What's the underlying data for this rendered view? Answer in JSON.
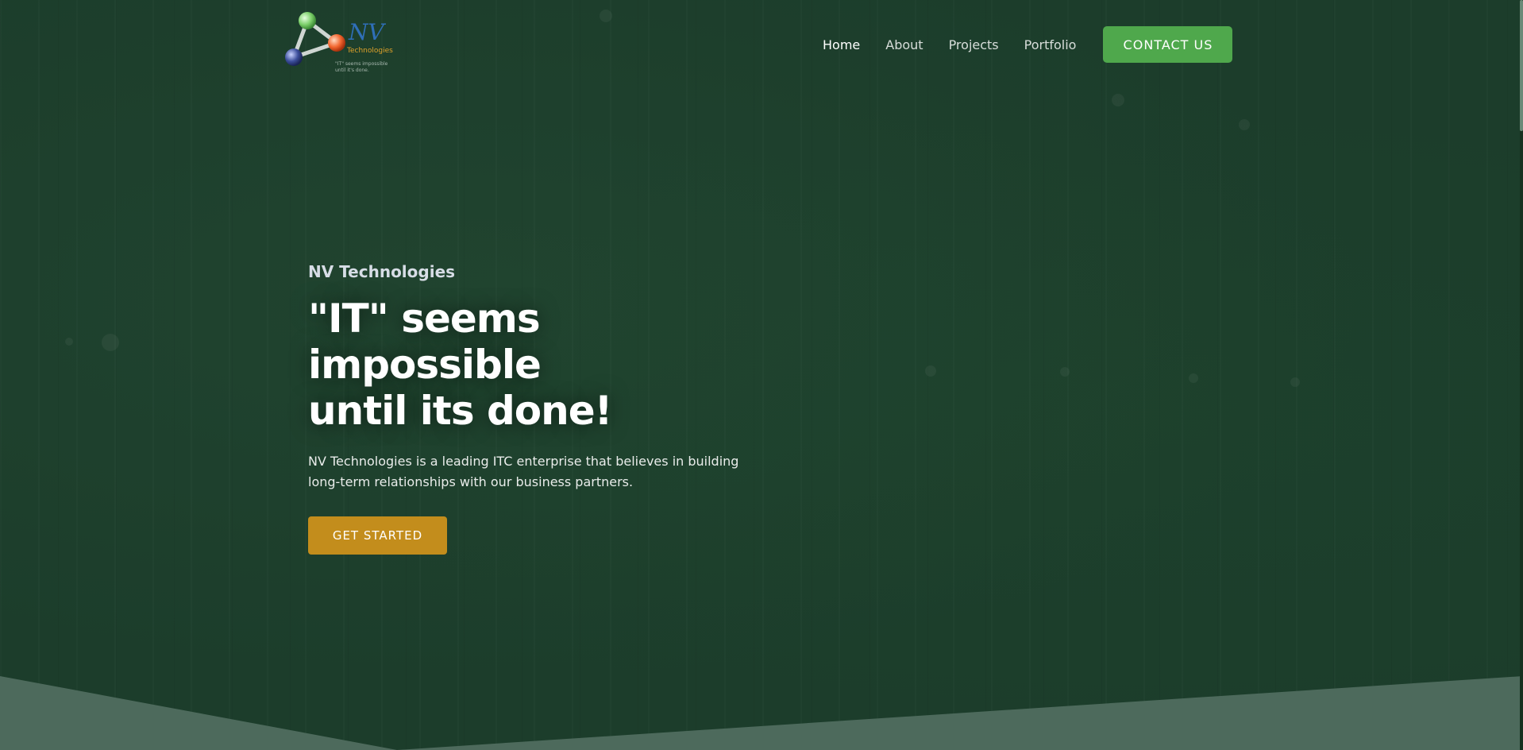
{
  "header": {
    "logo": {
      "brand": "NV",
      "brand_sub": "Technologies",
      "tagline_line1": "\"IT\" seems impossible",
      "tagline_line2": "until it's done."
    },
    "nav": [
      {
        "label": "Home",
        "active": true
      },
      {
        "label": "About",
        "active": false
      },
      {
        "label": "Projects",
        "active": false
      },
      {
        "label": "Portfolio",
        "active": false
      }
    ],
    "contact_label": "CONTACT US"
  },
  "hero": {
    "eyebrow": "NV Technologies",
    "title_line1": "\"IT\" seems impossible",
    "title_line2": "until its done!",
    "description": "NV Technologies is a leading ITC enterprise that believes in building long-term relationships with our business partners.",
    "cta_label": "GET STARTED"
  },
  "colors": {
    "background": "#1c3d2b",
    "contact_button": "#4fa84c",
    "cta_button": "#c38d1c",
    "wave": "#4d6a5c"
  }
}
